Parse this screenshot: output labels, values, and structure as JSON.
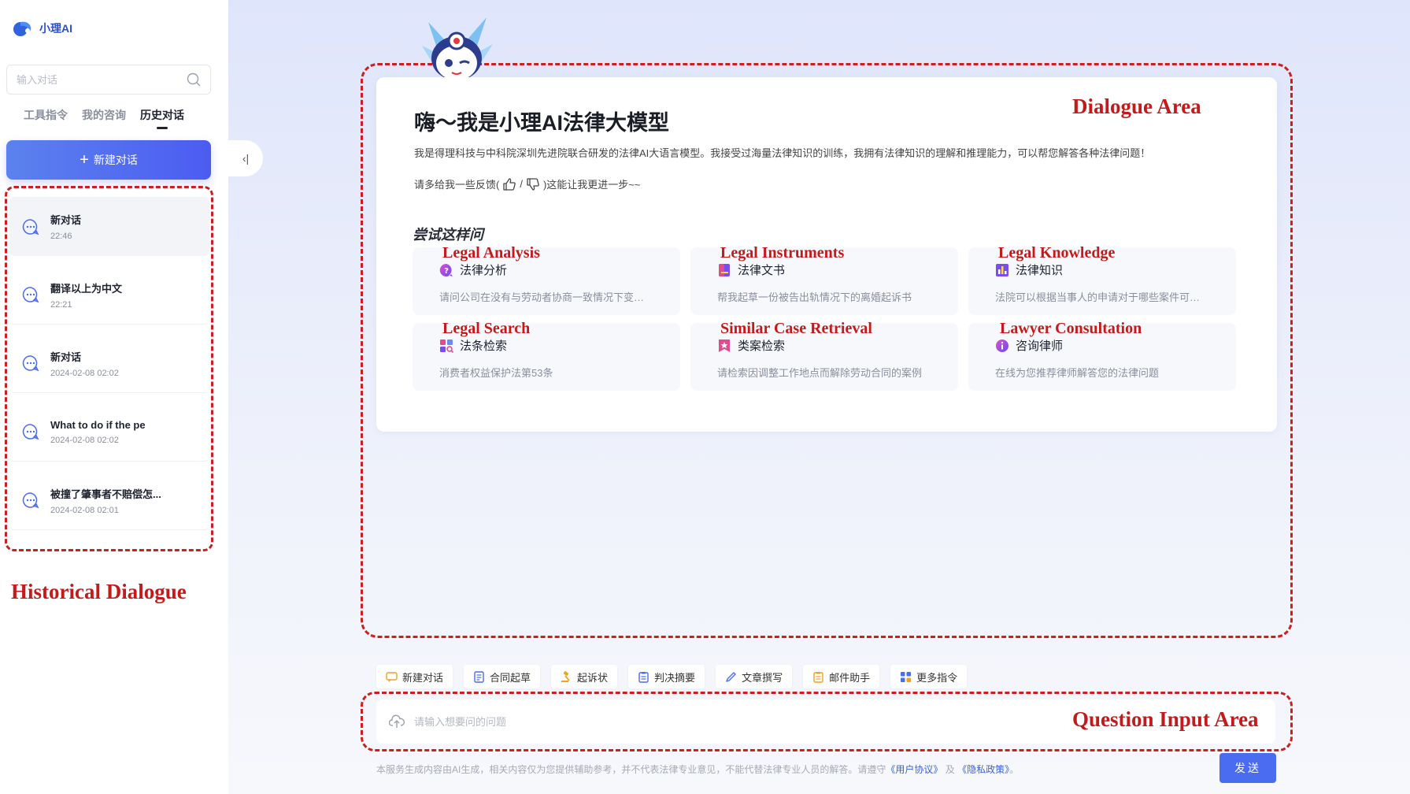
{
  "app": {
    "logo_text": "小理AI"
  },
  "sidebar": {
    "search_placeholder": "输入对话",
    "tabs": [
      {
        "label": "工具指令",
        "active": false
      },
      {
        "label": "我的咨询",
        "active": false
      },
      {
        "label": "历史对话",
        "active": true
      }
    ],
    "new_chat_label": "新建对话",
    "history": [
      {
        "title": "新对话",
        "time": "22:46",
        "active": true
      },
      {
        "title": "翻译以上为中文",
        "time": "22:21",
        "active": false
      },
      {
        "title": "新对话",
        "time": "2024-02-08 02:02",
        "active": false
      },
      {
        "title": "What to do if the pe",
        "time": "2024-02-08 02:02",
        "active": false
      },
      {
        "title": "被撞了肇事者不赔偿怎...",
        "time": "2024-02-08 02:01",
        "active": false
      }
    ],
    "collapse_label": "‹|"
  },
  "annotations": {
    "historical": "Historical Dialogue",
    "dialogue": "Dialogue Area",
    "input": "Question Input Area",
    "legal_analysis": "Legal Analysis",
    "legal_instruments": "Legal Instruments",
    "legal_knowledge": "Legal Knowledge",
    "legal_search": "Legal Search",
    "similar_case": "Similar Case Retrieval",
    "lawyer": "Lawyer Consultation"
  },
  "welcome": {
    "title": "嗨～我是小理AI法律大模型",
    "description": "我是得理科技与中科院深圳先进院联合研发的法律AI大语言模型。我接受过海量法律知识的训练，我拥有法律知识的理解和推理能力，可以帮您解答各种法律问题！",
    "feedback_prefix": "请多给我一些反馈(",
    "feedback_sep": "/",
    "feedback_suffix": ")这能让我更进一步~~",
    "try_title": "尝试这样问"
  },
  "suggestions": [
    {
      "title": "法律分析",
      "desc": "请问公司在没有与劳动者协商一致情况下变…",
      "icon": "question-bubble-icon"
    },
    {
      "title": "法律文书",
      "desc": "帮我起草一份被告出轨情况下的离婚起诉书",
      "icon": "document-book-icon"
    },
    {
      "title": "法律知识",
      "desc": "法院可以根据当事人的申请对于哪些案件可…",
      "icon": "bar-chart-icon"
    },
    {
      "title": "法条检索",
      "desc": "消费者权益保护法第53条",
      "icon": "search-grid-icon"
    },
    {
      "title": "类案检索",
      "desc": "请检索因调整工作地点而解除劳动合同的案例",
      "icon": "star-badge-icon"
    },
    {
      "title": "咨询律师",
      "desc": "在线为您推荐律师解答您的法律问题",
      "icon": "info-circle-icon"
    }
  ],
  "quick_actions": [
    {
      "label": "新建对话",
      "icon": "chat-icon"
    },
    {
      "label": "合同起草",
      "icon": "contract-icon"
    },
    {
      "label": "起诉状",
      "icon": "gavel-icon"
    },
    {
      "label": "判决摘要",
      "icon": "clipboard-icon"
    },
    {
      "label": "文章撰写",
      "icon": "pen-icon"
    },
    {
      "label": "邮件助手",
      "icon": "mail-clipboard-icon"
    },
    {
      "label": "更多指令",
      "icon": "grid-icon"
    }
  ],
  "input": {
    "placeholder": "请输入想要问的问题",
    "send_label": "发送"
  },
  "footer": {
    "disclaimer_prefix": "本服务生成内容由AI生成，相关内容仅为您提供辅助参考，并不代表法律专业意见，不能代替法律专业人员的解答。请遵守",
    "user_agreement": "《用户协议》",
    "and": "及",
    "privacy": "《隐私政策》",
    "end": "。"
  }
}
